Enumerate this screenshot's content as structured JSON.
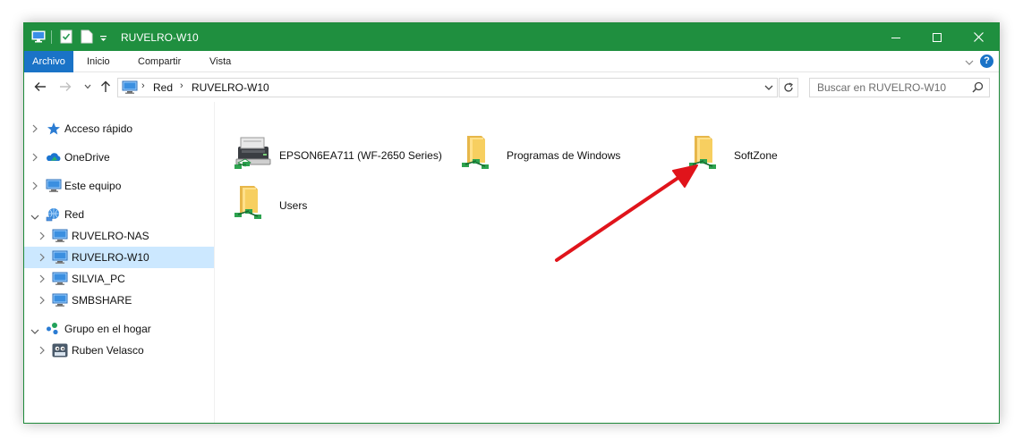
{
  "window": {
    "title": "RUVELRO-W10",
    "accent": "#1f8f3f",
    "ribbon_active": "#1a73c7",
    "quick_access_icons": [
      "computer-icon",
      "properties-icon",
      "new-folder-icon",
      "customize-dropdown-icon"
    ]
  },
  "ribbon": {
    "tabs": [
      "Archivo",
      "Inicio",
      "Compartir",
      "Vista"
    ],
    "help": "?"
  },
  "address": {
    "segments": [
      "Red",
      "RUVELRO-W10"
    ],
    "search_placeholder": "Buscar en RUVELRO-W10"
  },
  "nav": {
    "items": [
      {
        "label": "Acceso rápido",
        "icon": "star-icon"
      },
      {
        "label": "OneDrive",
        "icon": "onedrive-icon"
      },
      {
        "label": "Este equipo",
        "icon": "computer-icon"
      },
      {
        "label": "Red",
        "icon": "network-icon"
      },
      {
        "label": "RUVELRO-NAS",
        "icon": "computer-icon"
      },
      {
        "label": "RUVELRO-W10",
        "icon": "computer-icon",
        "selected": true
      },
      {
        "label": "SILVIA_PC",
        "icon": "computer-icon"
      },
      {
        "label": "SMBSHARE",
        "icon": "computer-icon"
      },
      {
        "label": "Grupo en el hogar",
        "icon": "homegroup-icon"
      },
      {
        "label": "Ruben Velasco",
        "icon": "user-avatar-icon"
      }
    ]
  },
  "content": {
    "items": [
      {
        "label": "EPSON6EA711 (WF-2650 Series)",
        "icon": "printer-icon"
      },
      {
        "label": "Programas de Windows",
        "icon": "shared-folder-icon"
      },
      {
        "label": "SoftZone",
        "icon": "shared-folder-icon"
      },
      {
        "label": "Users",
        "icon": "shared-folder-icon"
      }
    ]
  },
  "annotation": {
    "color": "#e0141b",
    "points_to": "SoftZone"
  }
}
